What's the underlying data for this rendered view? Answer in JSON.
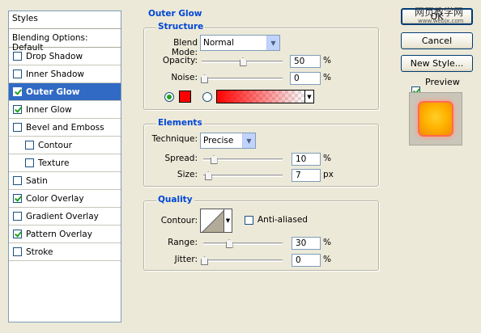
{
  "styles_panel": {
    "header": "Styles",
    "blending_options": "Blending Options: Default",
    "items": [
      {
        "label": "Drop Shadow",
        "checked": false,
        "sub": false,
        "selected": false
      },
      {
        "label": "Inner Shadow",
        "checked": false,
        "sub": false,
        "selected": false
      },
      {
        "label": "Outer Glow",
        "checked": true,
        "sub": false,
        "selected": true
      },
      {
        "label": "Inner Glow",
        "checked": true,
        "sub": false,
        "selected": false
      },
      {
        "label": "Bevel and Emboss",
        "checked": false,
        "sub": false,
        "selected": false
      },
      {
        "label": "Contour",
        "checked": false,
        "sub": true,
        "selected": false
      },
      {
        "label": "Texture",
        "checked": false,
        "sub": true,
        "selected": false
      },
      {
        "label": "Satin",
        "checked": false,
        "sub": false,
        "selected": false
      },
      {
        "label": "Color Overlay",
        "checked": true,
        "sub": false,
        "selected": false
      },
      {
        "label": "Gradient Overlay",
        "checked": false,
        "sub": false,
        "selected": false
      },
      {
        "label": "Pattern Overlay",
        "checked": true,
        "sub": false,
        "selected": false
      },
      {
        "label": "Stroke",
        "checked": false,
        "sub": false,
        "selected": false
      }
    ]
  },
  "outer_glow": {
    "title": "Outer Glow",
    "structure": {
      "title": "Structure",
      "blend_mode_label": "Blend Mode:",
      "blend_mode_value": "Normal",
      "opacity_label": "Opacity:",
      "opacity_value": "50",
      "opacity_unit": "%",
      "opacity_level": 0.5,
      "noise_label": "Noise:",
      "noise_value": "0",
      "noise_unit": "%",
      "noise_level": 0.0,
      "glow_color": "#ff0000",
      "gradient_start_color": "#ff0000"
    },
    "elements": {
      "title": "Elements",
      "technique_label": "Technique:",
      "technique_value": "Precise",
      "spread_label": "Spread:",
      "spread_value": "10",
      "spread_unit": "%",
      "spread_level": 0.1,
      "size_label": "Size:",
      "size_value": "7",
      "size_unit": "px",
      "size_level": 0.028
    },
    "quality": {
      "title": "Quality",
      "contour_label": "Contour:",
      "anti_aliased_label": "Anti-aliased",
      "anti_aliased_checked": false,
      "range_label": "Range:",
      "range_value": "30",
      "range_unit": "%",
      "range_level": 0.3,
      "jitter_label": "Jitter:",
      "jitter_value": "0",
      "jitter_unit": "%",
      "jitter_level": 0.0
    }
  },
  "buttons": {
    "ok": "OK",
    "cancel": "Cancel",
    "new_style": "New Style...",
    "preview_label": "Preview",
    "preview_checked": true
  },
  "watermark": {
    "line1": "网页教学网",
    "line2": "www.webjx.com"
  },
  "colors": {
    "accent": "#316ac5",
    "section_title": "#0046d5",
    "glow": "#ff0000",
    "preview_fill": "#ffbf00"
  }
}
